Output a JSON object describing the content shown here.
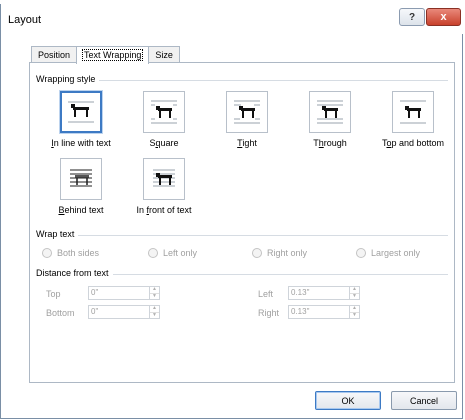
{
  "window": {
    "title": "Layout",
    "help": "?",
    "close": "x"
  },
  "tabs": [
    {
      "label": "Position"
    },
    {
      "label": "Text Wrapping"
    },
    {
      "label": "Size"
    }
  ],
  "wrapping_style": {
    "heading": "Wrapping style",
    "selected": "In line with text",
    "options": [
      {
        "label": "In line with text",
        "accel": "I",
        "icon": "inline-wrap-icon"
      },
      {
        "label": "Square",
        "accel": "q",
        "icon": "square-wrap-icon"
      },
      {
        "label": "Tight",
        "accel": "T",
        "icon": "tight-wrap-icon"
      },
      {
        "label": "Through",
        "accel": "h",
        "icon": "through-wrap-icon"
      },
      {
        "label": "Top and bottom",
        "accel": "o",
        "icon": "top-bottom-wrap-icon"
      },
      {
        "label": "Behind text",
        "accel": "B",
        "icon": "behind-text-icon"
      },
      {
        "label": "In front of text",
        "accel": "f",
        "icon": "in-front-text-icon"
      }
    ]
  },
  "wrap_text": {
    "heading": "Wrap text",
    "options": [
      {
        "label": "Both sides"
      },
      {
        "label": "Left only"
      },
      {
        "label": "Right only"
      },
      {
        "label": "Largest only"
      }
    ]
  },
  "distance": {
    "heading": "Distance from text",
    "top": {
      "label": "Top",
      "value": "0\""
    },
    "bottom": {
      "label": "Bottom",
      "value": "0\""
    },
    "left": {
      "label": "Left",
      "value": "0.13\""
    },
    "right": {
      "label": "Right",
      "value": "0.13\""
    }
  },
  "footer": {
    "ok": "OK",
    "cancel": "Cancel"
  }
}
